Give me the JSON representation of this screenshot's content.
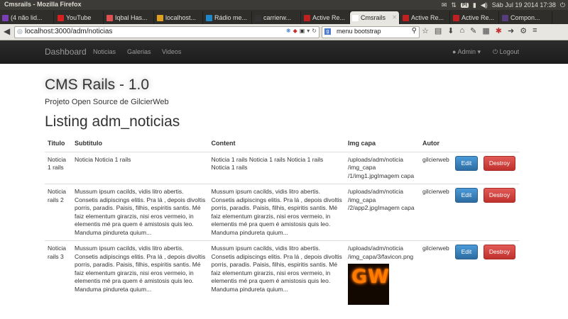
{
  "os": {
    "window_title": "Cmsrails - Mozilla Firefox",
    "clock": "Sáb Jul 19 2014 17:38",
    "indicator": "Pt"
  },
  "tabs": [
    {
      "label": "(4 não lid...",
      "fav_color": "#7b3fb5"
    },
    {
      "label": "YouTube",
      "fav_color": "#d62020"
    },
    {
      "label": "Iqbal Has...",
      "fav_color": "#e05050"
    },
    {
      "label": "localhost...",
      "fav_color": "#e0a020"
    },
    {
      "label": "Rádio me...",
      "fav_color": "#1e88c8"
    },
    {
      "label": "carrierw...",
      "fav_color": "#333333"
    },
    {
      "label": "Active Re...",
      "fav_color": "#c02020"
    },
    {
      "label": "Cmsrails",
      "fav_color": "#ffffff"
    },
    {
      "label": "Active Re...",
      "fav_color": "#c02020"
    },
    {
      "label": "Active Re...",
      "fav_color": "#c02020"
    },
    {
      "label": "Compon...",
      "fav_color": "#563d7c"
    }
  ],
  "toolbar": {
    "url": "localhost:3000/adm/noticias",
    "search_query": "menu bootstrap"
  },
  "navbar": {
    "brand": "Dashboard",
    "links": [
      "Noticias",
      "Galerias",
      "Videos"
    ],
    "admin": "Admin",
    "logout": "Logout"
  },
  "hero": {
    "title": "CMS Rails - 1.0",
    "subtitle": "Projeto Open Source de GilcierWeb"
  },
  "listing_title": "Listing adm_noticias",
  "table": {
    "headers": [
      "Titulo",
      "Subtitulo",
      "Content",
      "Img capa",
      "Autor"
    ],
    "rows": [
      {
        "titulo": "Noticia 1 rails",
        "subtitulo": "Noticia Noticia 1 rails",
        "content": "Noticia 1 rails Noticia 1 rails Noticia 1 rails Noticia 1 rails",
        "img_capa": "/uploads/adm/noticia /img_capa /1/img1.jpgImagem capa",
        "autor": "gilcierweb"
      },
      {
        "titulo": "Noticia rails 2",
        "subtitulo": "Mussum ipsum cacilds, vidis litro abertis. Consetis adipiscings elitis. Pra lá , depois divoltis porris, paradis. Paisis, filhis, espiritis santis. Mé faiz elementum girarzis, nisi eros vermeio, in elementis mé pra quem é amistosis quis leo. Manduma pindureta quium...",
        "content": "Mussum ipsum cacilds, vidis litro abertis. Consetis adipiscings elitis. Pra lá , depois divoltis porris, paradis. Paisis, filhis, espiritis santis. Mé faiz elementum girarzis, nisi eros vermeio, in elementis mé pra quem é amistosis quis leo. Manduma pindureta quium...",
        "img_capa": "/uploads/adm/noticia /img_capa /2/app2.jpgImagem capa",
        "autor": "gilcierweb"
      },
      {
        "titulo": "Noticia rails 3",
        "subtitulo": "Mussum ipsum cacilds, vidis litro abertis. Consetis adipiscings elitis. Pra lá , depois divoltis porris, paradis. Paisis, filhis, espiritis santis. Mé faiz elementum girarzis, nisi eros vermeio, in elementis mé pra quem é amistosis quis leo. Manduma pindureta quium...",
        "content": "Mussum ipsum cacilds, vidis litro abertis. Consetis adipiscings elitis. Pra lá , depois divoltis porris, paradis. Paisis, filhis, espiritis santis. Mé faiz elementum girarzis, nisi eros vermeio, in elementis mé pra quem é amistosis quis leo. Manduma pindureta quium...",
        "img_capa": "/uploads/adm/noticia /img_capa/3/favicon.png",
        "img_logo_text": "GW",
        "autor": "gilcierweb"
      }
    ],
    "edit_label": "Edit",
    "destroy_label": "Destroy"
  },
  "colors": {
    "navbar_bg": "#222222",
    "edit_btn": "#3276b1",
    "destroy_btn": "#d2322d",
    "os_panel": "#3c3b37"
  }
}
